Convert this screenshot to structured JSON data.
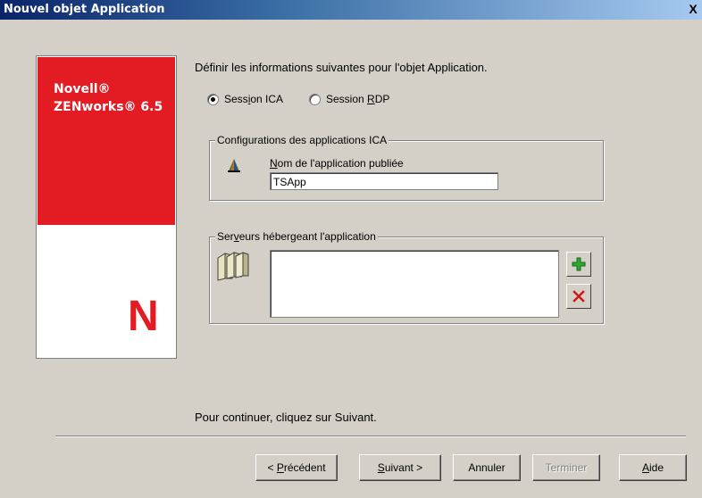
{
  "window": {
    "title": "Nouvel objet Application",
    "close_label": "X"
  },
  "logo": {
    "line1": "Novell®",
    "line2": "ZENworks® 6.5",
    "mark": "N",
    "brand_color": "#e31b23"
  },
  "intro_text": "Définir les informations suivantes pour l'objet Application.",
  "session": {
    "ica": {
      "pre": "Sess",
      "accel": "i",
      "post": "on ICA",
      "checked": true
    },
    "rdp": {
      "pre": "Session ",
      "accel": "R",
      "post": "DP",
      "checked": false
    }
  },
  "ica_group": {
    "legend": "Configurations des applications ICA",
    "field_label_pre": "",
    "field_label_accel": "N",
    "field_label_post": "om de l'application publiée",
    "field_value": "TSApp",
    "icon": "application-icon"
  },
  "servers_group": {
    "legend_pre": "Ser",
    "legend_accel": "v",
    "legend_post": "eurs hébergeant l'application",
    "icon": "servers-icon",
    "add_icon": "plus-icon",
    "remove_icon": "x-icon"
  },
  "continue_text": "Pour continuer, cliquez sur Suivant.",
  "buttons": {
    "back": {
      "pre": "< ",
      "accel": "P",
      "post": "récédent"
    },
    "next": {
      "pre": "",
      "accel": "S",
      "post": "uivant >"
    },
    "cancel": "Annuler",
    "finish": "Terminer",
    "help": {
      "pre": "",
      "accel": "A",
      "post": "ide"
    }
  }
}
